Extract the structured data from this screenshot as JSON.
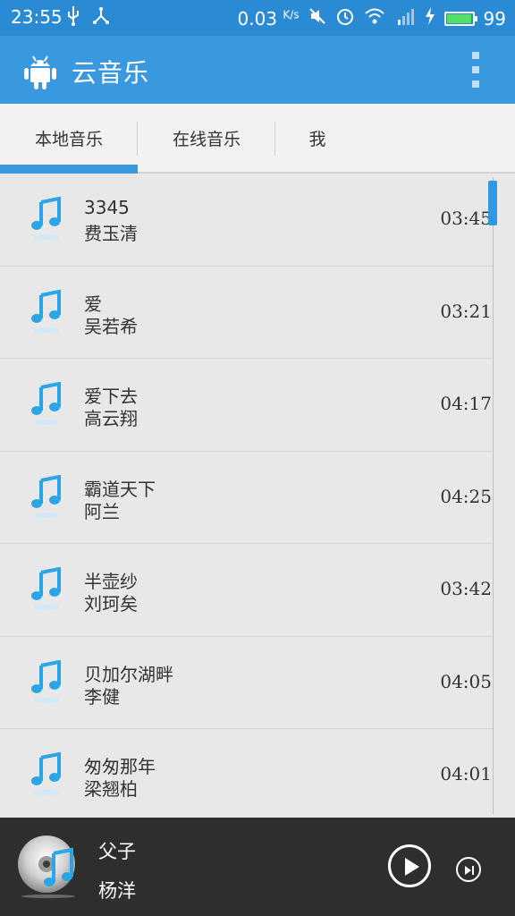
{
  "status_bar": {
    "time": "23:55",
    "speed_value": "0.03",
    "speed_unit": "K/s",
    "battery_level": "99",
    "battery_fill_fraction": 0.99
  },
  "app_bar": {
    "title": "云音乐"
  },
  "tabs": [
    {
      "label": "本地音乐",
      "selected": true
    },
    {
      "label": "在线音乐",
      "selected": false
    },
    {
      "label": "我",
      "selected": false
    }
  ],
  "songs": [
    {
      "title": "3345",
      "artist": "费玉清",
      "duration": "03:45"
    },
    {
      "title": "爱",
      "artist": "吴若希",
      "duration": "03:21"
    },
    {
      "title": "爱下去",
      "artist": "高云翔",
      "duration": "04:17"
    },
    {
      "title": "霸道天下",
      "artist": "阿兰",
      "duration": "04:25"
    },
    {
      "title": "半壶纱",
      "artist": "刘珂矣",
      "duration": "03:42"
    },
    {
      "title": "贝加尔湖畔",
      "artist": "李健",
      "duration": "04:05"
    },
    {
      "title": "匆匆那年",
      "artist": "梁翘柏",
      "duration": "04:01"
    }
  ],
  "now_playing": {
    "title": "父子",
    "artist": "杨洋"
  },
  "colors": {
    "status_bar": "#2a8ad3",
    "app_bar": "#3a99de",
    "accent": "#3a99de",
    "player_bg": "#2e2e2e"
  }
}
